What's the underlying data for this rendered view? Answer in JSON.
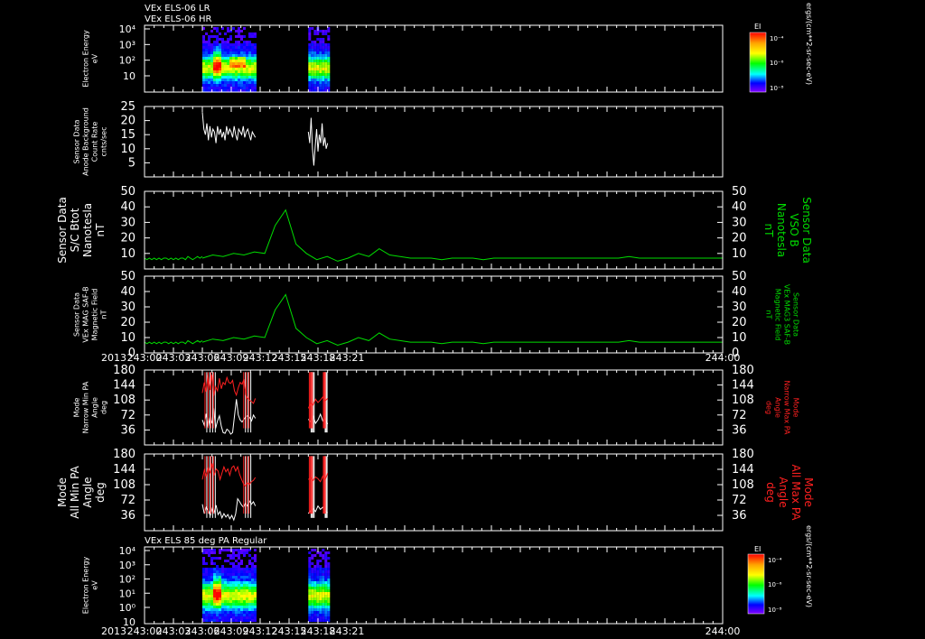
{
  "header": {
    "line1": "VEx ELS-06 LR",
    "line2": "VEx ELS-06 HR"
  },
  "bottom_title": "VEx ELS 85 deg PA Regular",
  "year_label": "2013",
  "time_ticks": [
    "243:00",
    "243:03",
    "243:06",
    "243:09",
    "243:12",
    "243:15",
    "243:18",
    "243:21",
    "244:00"
  ],
  "colorbar": {
    "title": "EI",
    "units": "ergs/(cm**2-sr-sec-eV)",
    "labels": [
      "10⁻⁴",
      "10⁻⁶",
      "10⁻⁸"
    ],
    "colors": [
      "#ff0000",
      "#ffa500",
      "#ffff00",
      "#00ff00",
      "#00ffff",
      "#0000ff",
      "#8000ff"
    ]
  },
  "chart_data": [
    {
      "type": "heatmap",
      "title": "VEx ELS-06 LR / VEx ELS-06 HR",
      "ylabel": [
        "Electron Energy",
        "eV"
      ],
      "ytick_labels": [
        "10",
        "10²",
        "10³",
        "10⁴"
      ],
      "ylog": true,
      "data_spans": [
        [
          "243:06",
          "243:11.5"
        ],
        [
          "243:17",
          "243:19"
        ]
      ],
      "colors": {
        "low": "#5040ff",
        "high": "#ff0000"
      }
    },
    {
      "type": "line",
      "ylabel": [
        "Sensor Data",
        "Anode Background",
        "Count Rate",
        "cnts/sec"
      ],
      "yticks": [
        5,
        10,
        15,
        20,
        25
      ],
      "ylim": [
        0,
        25
      ],
      "series": [
        {
          "color": "#ffffff",
          "segments": [
            {
              "start": "243:06",
              "end": "243:11.5",
              "values": [
                23,
                17,
                15,
                19,
                13,
                18,
                14,
                17,
                16,
                12,
                18,
                15,
                17,
                14,
                16,
                13,
                18,
                15,
                17,
                16,
                14,
                18,
                15,
                13,
                17,
                16,
                15,
                18,
                14,
                16,
                17,
                15,
                13,
                16,
                15,
                14
              ]
            },
            {
              "start": "243:17",
              "end": "243:19",
              "values": [
                16,
                12,
                21,
                10,
                4,
                11,
                17,
                9,
                15,
                12,
                19,
                11,
                14,
                10,
                12
              ]
            }
          ]
        }
      ]
    },
    {
      "type": "line",
      "ylabel": [
        "Sensor Data",
        "S/C Btot",
        "Nanotesla",
        "nT"
      ],
      "ylabel_right": [
        "Sensor Data",
        "VSO B",
        "Nanotesla",
        "nT"
      ],
      "yticks": [
        10,
        20,
        30,
        40,
        50
      ],
      "ylim": [
        0,
        50
      ],
      "series": [
        {
          "color": "#00dd00",
          "segments": [
            {
              "start": "243:00",
              "end": "243:06",
              "values": [
                7,
                6,
                7,
                6,
                7,
                6,
                7,
                6,
                7,
                7,
                6,
                7,
                6,
                7,
                6,
                7,
                7,
                6,
                8,
                7,
                6,
                7,
                8,
                7,
                8
              ]
            },
            {
              "start": "243:06",
              "end": "244:00",
              "values": [
                7,
                9,
                8,
                10,
                9,
                11,
                10,
                28,
                38,
                16,
                10,
                6,
                8,
                5,
                7,
                10,
                8,
                13,
                9,
                8,
                7,
                7,
                7,
                6,
                7,
                7,
                7,
                6,
                7,
                7,
                7,
                7,
                7,
                7,
                7,
                7,
                7,
                7,
                7,
                7,
                7,
                8,
                7,
                7,
                7,
                7,
                7,
                7,
                7,
                7,
                7
              ]
            }
          ]
        }
      ]
    },
    {
      "type": "line",
      "ylabel": [
        "Sensor Data",
        "VEx MAG SAF-B",
        "Magnetic Field",
        "nT"
      ],
      "ylabel_right": [
        "Sensor Data",
        "VEx MAG3 SAF-B",
        "Magnetic Field",
        "nT"
      ],
      "yticks": [
        0,
        10,
        20,
        30,
        40,
        50
      ],
      "ylim": [
        0,
        50
      ],
      "series": [
        {
          "color": "#00dd00",
          "segments": [
            {
              "start": "243:00",
              "end": "243:06",
              "values": [
                7,
                6,
                7,
                6,
                7,
                6,
                7,
                6,
                7,
                7,
                6,
                7,
                6,
                7,
                6,
                7,
                7,
                6,
                8,
                7,
                6,
                7,
                8,
                7,
                8
              ]
            },
            {
              "start": "243:06",
              "end": "244:00",
              "values": [
                7,
                9,
                8,
                10,
                9,
                11,
                10,
                28,
                38,
                16,
                10,
                6,
                8,
                5,
                7,
                10,
                8,
                13,
                9,
                8,
                7,
                7,
                7,
                6,
                7,
                7,
                7,
                6,
                7,
                7,
                7,
                7,
                7,
                7,
                7,
                7,
                7,
                7,
                7,
                7,
                7,
                8,
                7,
                7,
                7,
                7,
                7,
                7,
                7,
                7,
                7
              ]
            }
          ]
        }
      ]
    },
    {
      "type": "line",
      "ylabel": [
        "Mode",
        "Narrow Min PA",
        "Angle",
        "deg"
      ],
      "ylabel_right": [
        "Mode",
        "Narrow Max PA",
        "Angle",
        "deg"
      ],
      "yticks": [
        36,
        72,
        108,
        144,
        180
      ],
      "ylim": [
        0,
        180
      ],
      "series": [
        {
          "name": "Min PA",
          "color": "#ffffff",
          "segments": [
            {
              "start": "243:06",
              "end": "243:11.5",
              "values": [
                60,
                48,
                75,
                42,
                66,
                52,
                88,
                40,
                58,
                70,
                45,
                30,
                28,
                38,
                34,
                26,
                30,
                70,
                110,
                72,
                60,
                55,
                62,
                68,
                70,
                66,
                58,
                72,
                64
              ]
            },
            {
              "start": "243:17",
              "end": "243:19",
              "values": [
                62,
                55,
                70,
                52,
                60,
                74,
                58,
                66,
                50
              ]
            }
          ]
        },
        {
          "name": "Max PA",
          "color": "#ff2020",
          "segments": [
            {
              "start": "243:06",
              "end": "243:11.5",
              "values": [
                125,
                150,
                128,
                170,
                132,
                168,
                118,
                140,
                130,
                160,
                135,
                150,
                145,
                162,
                150,
                148,
                155,
                130,
                120,
                138,
                150,
                146,
                158,
                120,
                112,
                108,
                104,
                100,
                112
              ]
            },
            {
              "start": "243:17",
              "end": "243:19",
              "values": [
                88,
                100,
                96,
                110,
                102,
                108,
                115,
                106,
                112
              ]
            }
          ]
        }
      ]
    },
    {
      "type": "line",
      "ylabel": [
        "Mode",
        "All Min PA",
        "Angle",
        "deg"
      ],
      "ylabel_right": [
        "Mode",
        "All Max PA",
        "Angle",
        "deg"
      ],
      "yticks": [
        36,
        72,
        108,
        144,
        180
      ],
      "ylim": [
        0,
        180
      ],
      "series": [
        {
          "name": "Min PA",
          "color": "#ffffff",
          "segments": [
            {
              "start": "243:06",
              "end": "243:11.5",
              "values": [
                62,
                40,
                55,
                48,
                35,
                52,
                42,
                60,
                38,
                45,
                30,
                40,
                32,
                38,
                28,
                36,
                25,
                40,
                75,
                68,
                60,
                55,
                65,
                58,
                70,
                62,
                68,
                58
              ]
            },
            {
              "start": "243:17",
              "end": "243:19",
              "values": [
                40,
                48,
                52,
                45,
                58,
                50,
                55,
                46,
                42
              ]
            }
          ]
        },
        {
          "name": "Max PA",
          "color": "#ff2020",
          "segments": [
            {
              "start": "243:06",
              "end": "243:11.5",
              "values": [
                120,
                142,
                128,
                150,
                135,
                158,
                130,
                145,
                140,
                120,
                135,
                150,
                138,
                145,
                130,
                148,
                152,
                140,
                150,
                132,
                120,
                110,
                105,
                112,
                108,
                115,
                118,
                125
              ]
            },
            {
              "start": "243:17",
              "end": "243:19",
              "values": [
                120,
                124,
                118,
                126,
                122,
                115,
                128,
                120,
                135
              ]
            }
          ]
        }
      ]
    },
    {
      "type": "heatmap",
      "title": "VEx ELS 85 deg PA Regular",
      "ylabel": [
        "Electron Energy",
        "eV"
      ],
      "ytick_labels": [
        "10⁰",
        "10¹",
        "10²",
        "10³",
        "10⁴"
      ],
      "extra_tick": "10",
      "ylog": true,
      "data_spans": [
        [
          "243:06",
          "243:11.5"
        ],
        [
          "243:17",
          "243:19"
        ]
      ],
      "colors": {
        "low": "#5040ff",
        "high": "#ff0000"
      }
    }
  ]
}
